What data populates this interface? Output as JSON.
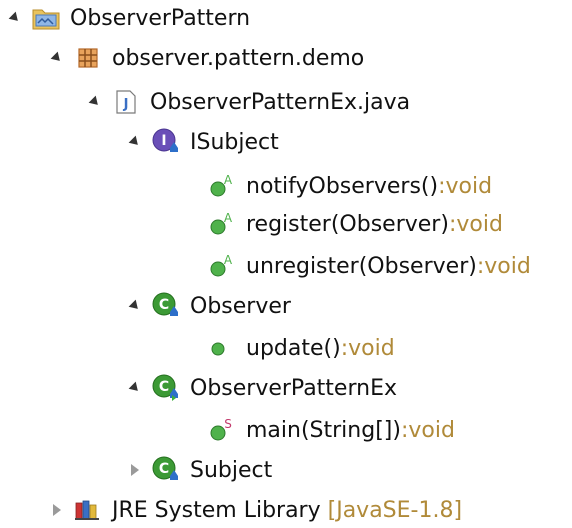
{
  "tree": {
    "project": {
      "label": "ObserverPattern"
    },
    "package": {
      "label": "observer.pattern.demo"
    },
    "file": {
      "label": "ObserverPatternEx.java"
    },
    "isubject": {
      "label": "ISubject"
    },
    "notify": {
      "name": "notifyObservers()",
      "type": "void"
    },
    "register": {
      "name": "register(Observer)",
      "type": "void"
    },
    "unregister": {
      "name": "unregister(Observer)",
      "type": "void"
    },
    "observer": {
      "label": "Observer"
    },
    "update": {
      "name": "update()",
      "type": "void"
    },
    "observerpatternex": {
      "label": "ObserverPatternEx"
    },
    "main": {
      "name": "main(String[])",
      "type": "void"
    },
    "subject": {
      "label": "Subject"
    },
    "jre": {
      "label": "JRE System Library",
      "suffix": "[JavaSE-1.8]"
    },
    "separator": " : "
  },
  "icons": {
    "project": "project-folder-icon",
    "package": "package-icon",
    "file": "java-file-icon",
    "interface": "interface-icon",
    "class": "class-icon",
    "abstract_method": "abstract-method-icon",
    "method": "public-method-icon",
    "static_method": "static-method-icon",
    "library": "library-icon"
  },
  "colors": {
    "type_text": "#b08a39",
    "method_green": "#4fb24b",
    "interface_purple": "#6a4fb8",
    "class_green": "#3c9a35"
  }
}
